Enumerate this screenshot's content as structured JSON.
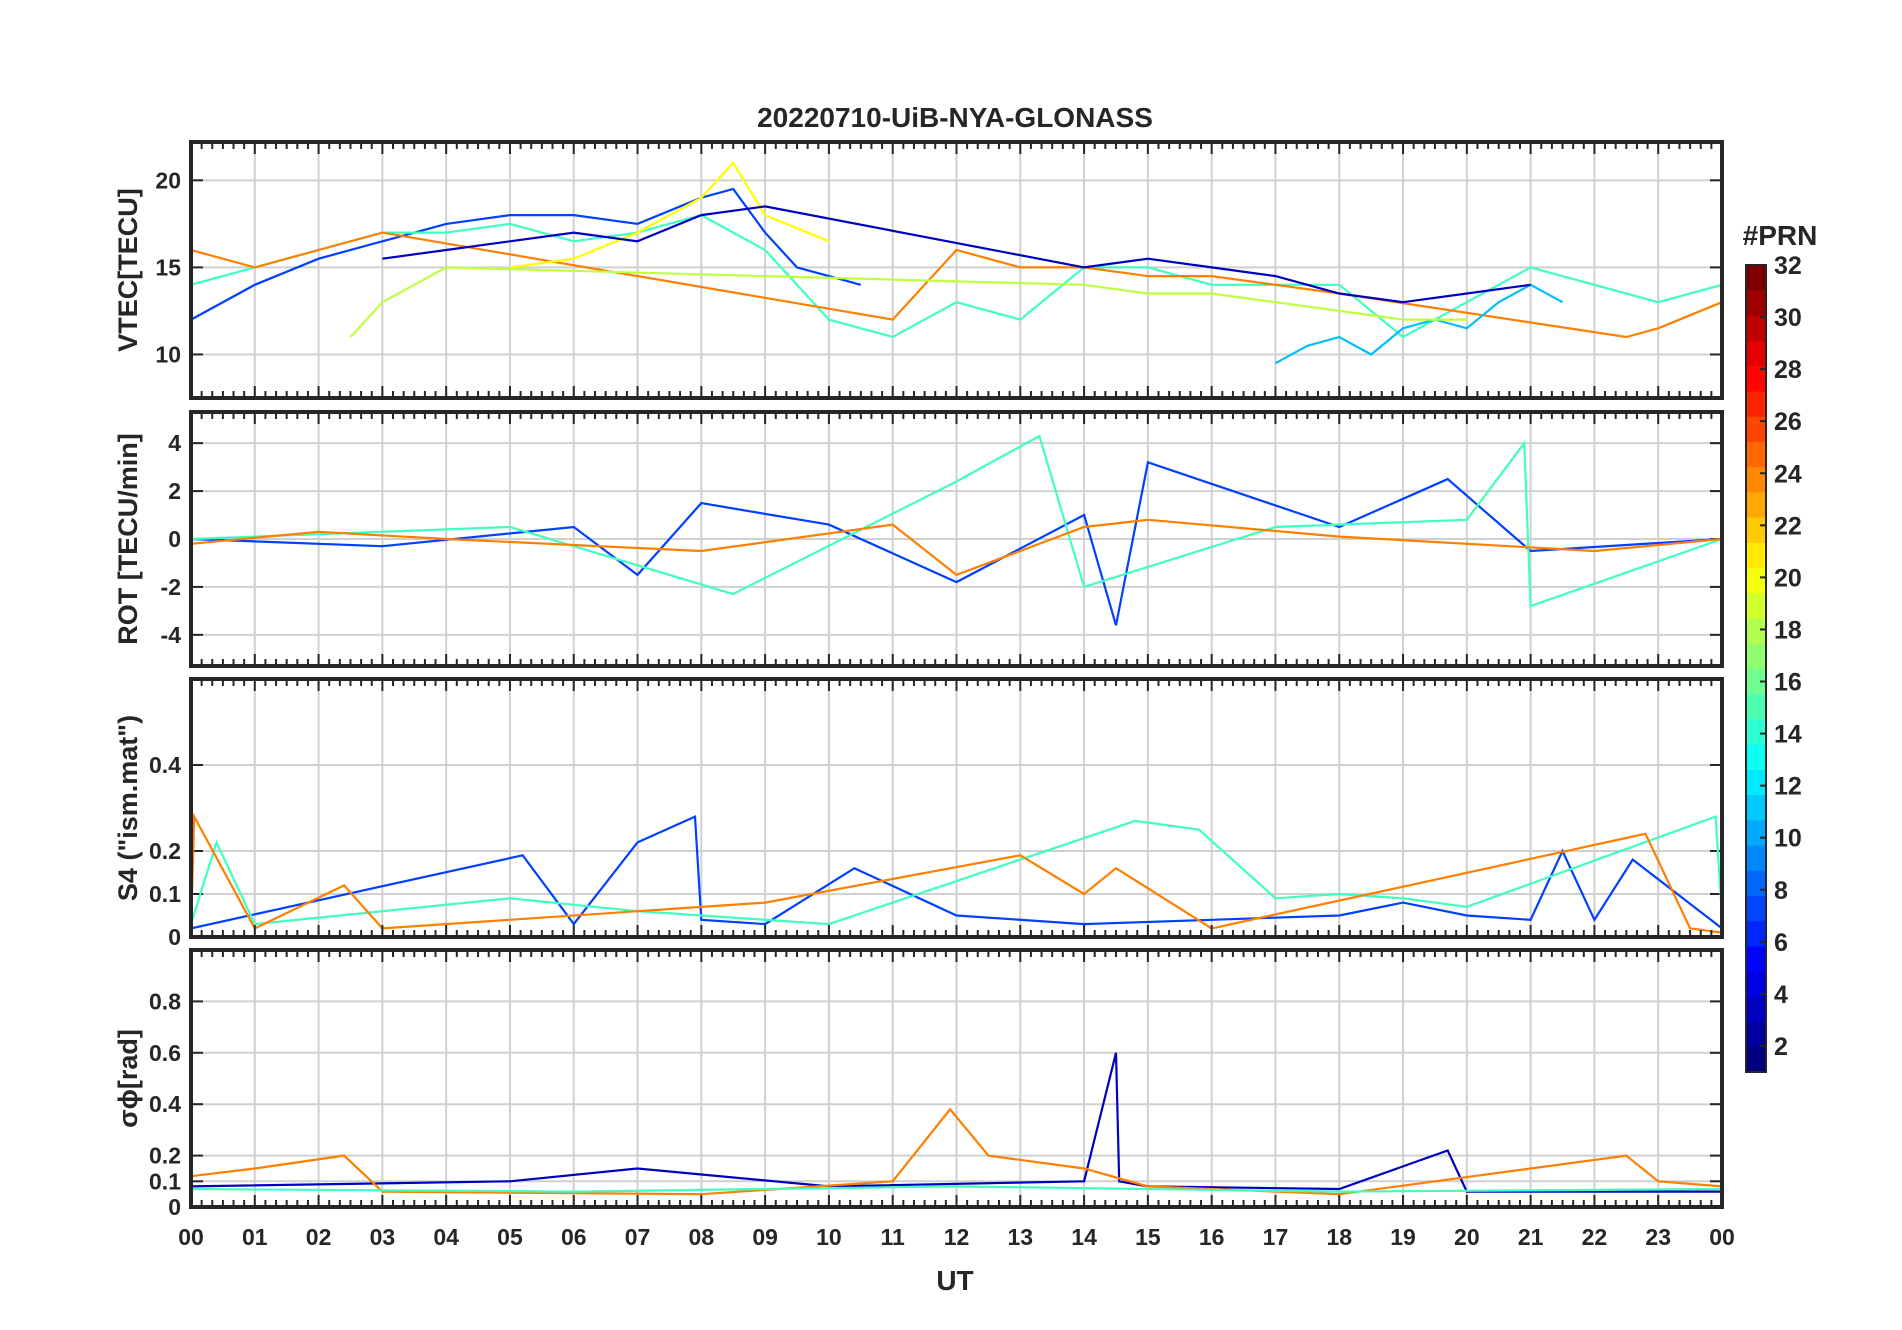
{
  "title": "20220710-UiB-NYA-GLONASS",
  "xlabel": "UT",
  "x_tick_labels": [
    "00",
    "01",
    "02",
    "03",
    "04",
    "05",
    "06",
    "07",
    "08",
    "09",
    "10",
    "11",
    "12",
    "13",
    "14",
    "15",
    "16",
    "17",
    "18",
    "19",
    "20",
    "21",
    "22",
    "23",
    "00"
  ],
  "colorbar": {
    "title": "#PRN",
    "range": [
      1,
      32
    ],
    "tick_labels": [
      "2",
      "4",
      "6",
      "8",
      "10",
      "12",
      "14",
      "16",
      "18",
      "20",
      "22",
      "24",
      "26",
      "28",
      "30",
      "32"
    ],
    "colormap": "jet"
  },
  "chart_data": [
    {
      "type": "line",
      "panel": "vtec",
      "ylabel": "VTEC[TECU]",
      "ylim": [
        7.5,
        22.2
      ],
      "yticks": [
        10,
        15,
        20
      ],
      "y_tick_labels": [
        "10",
        "15",
        "20"
      ],
      "xlim_hours": [
        0,
        24
      ],
      "grid": true,
      "series": [
        {
          "prn": 4,
          "color": "#0040ff",
          "x": [
            0,
            1,
            2,
            3,
            4,
            5,
            6,
            7,
            8,
            8.5,
            9,
            9.5,
            10,
            10.5
          ],
          "y": [
            12,
            14,
            15.5,
            16.5,
            17.5,
            18,
            18,
            17.5,
            19,
            19.5,
            17,
            15,
            14.5,
            14
          ]
        },
        {
          "prn": 15,
          "color": "#40ffbf",
          "x": [
            0,
            1,
            2,
            3,
            4,
            5,
            6,
            7,
            8,
            9,
            10,
            11,
            12,
            13,
            14,
            15,
            16,
            17,
            18,
            19,
            20,
            21,
            22,
            23,
            24
          ],
          "y": [
            14,
            15,
            16,
            17,
            17,
            17.5,
            16.5,
            17,
            18,
            16,
            12,
            11,
            13,
            12,
            15,
            15,
            14,
            14,
            14,
            11,
            13,
            15,
            14,
            13,
            14
          ]
        },
        {
          "prn": 23,
          "color": "#ff7f00",
          "x": [
            0,
            1,
            2,
            3,
            11,
            12,
            13,
            14,
            15,
            16,
            17,
            18,
            22.5,
            23,
            24
          ],
          "y": [
            16,
            15,
            16,
            17,
            12,
            16,
            15,
            15,
            14.5,
            14.5,
            14,
            13.5,
            11,
            11.5,
            13
          ]
        },
        {
          "prn": 20,
          "color": "#ffff00",
          "x": [
            5,
            6,
            7,
            8,
            8.5,
            9,
            10
          ],
          "y": [
            15,
            15.5,
            17,
            19,
            21,
            18,
            16.5
          ]
        },
        {
          "prn": 11,
          "color": "#00bfff",
          "x": [
            17,
            17.5,
            18,
            18.5,
            19,
            19.5,
            20,
            20.5,
            21,
            21.5
          ],
          "y": [
            9.5,
            10.5,
            11,
            10,
            11.5,
            12,
            11.5,
            13,
            14,
            13
          ]
        },
        {
          "prn": 2,
          "color": "#0000bf",
          "x": [
            3,
            4,
            5,
            6,
            7,
            8,
            9,
            14,
            15,
            16,
            17,
            18,
            19,
            20,
            21
          ],
          "y": [
            15.5,
            16,
            16.5,
            17,
            16.5,
            18,
            18.5,
            15,
            15.5,
            15,
            14.5,
            13.5,
            13,
            13.5,
            14
          ]
        },
        {
          "prn": 18,
          "color": "#bfff40",
          "x": [
            2.5,
            3,
            4,
            14,
            15,
            16,
            17,
            18,
            19,
            20
          ],
          "y": [
            11,
            13,
            15,
            14,
            13.5,
            13.5,
            13,
            12.5,
            12,
            12
          ]
        }
      ]
    },
    {
      "type": "line",
      "panel": "rot",
      "ylabel": "ROT [TECU/min]",
      "ylim": [
        -5.3,
        5.3
      ],
      "yticks": [
        -4,
        -2,
        0,
        2,
        4
      ],
      "y_tick_labels": [
        "-4",
        "-2",
        "0",
        "2",
        "4"
      ],
      "xlim_hours": [
        0,
        24
      ],
      "grid": true,
      "series": [
        {
          "prn": 4,
          "color": "#0040ff",
          "x": [
            0,
            3,
            6,
            7,
            8,
            10,
            12,
            14,
            14.5,
            15,
            18,
            19.7,
            21,
            24
          ],
          "y": [
            0,
            -0.3,
            0.5,
            -1.5,
            1.5,
            0.6,
            -1.8,
            1,
            -3.6,
            3.2,
            0.5,
            2.5,
            -0.5,
            0
          ]
        },
        {
          "prn": 15,
          "color": "#40ffbf",
          "x": [
            0,
            5,
            8.5,
            12,
            13.3,
            14,
            17,
            20,
            20.9,
            21,
            24
          ],
          "y": [
            0,
            0.5,
            -2.3,
            2.4,
            4.3,
            -2,
            0.5,
            0.8,
            4,
            -2.8,
            0
          ]
        },
        {
          "prn": 23,
          "color": "#ff7f00",
          "x": [
            0,
            2,
            4,
            8,
            11,
            12,
            14,
            15,
            18,
            22,
            24
          ],
          "y": [
            -0.2,
            0.3,
            0,
            -0.5,
            0.6,
            -1.5,
            0.5,
            0.8,
            0.1,
            -0.5,
            0
          ]
        }
      ]
    },
    {
      "type": "line",
      "panel": "s4",
      "ylabel": "S4 (\"ism.mat\")",
      "ylim": [
        0,
        0.6
      ],
      "yticks": [
        0,
        0.1,
        0.2,
        0.4
      ],
      "y_tick_labels": [
        "0",
        "0.1",
        "0.2",
        "0.4"
      ],
      "xlim_hours": [
        0,
        24
      ],
      "grid": true,
      "series": [
        {
          "prn": 4,
          "color": "#0040ff",
          "x": [
            0,
            5.2,
            6,
            7,
            7.9,
            8,
            9,
            10.4,
            12,
            14,
            16,
            18,
            19,
            20,
            21,
            21.5,
            22,
            22.6,
            24
          ],
          "y": [
            0.02,
            0.19,
            0.03,
            0.22,
            0.28,
            0.04,
            0.03,
            0.16,
            0.05,
            0.03,
            0.04,
            0.05,
            0.08,
            0.05,
            0.04,
            0.2,
            0.04,
            0.18,
            0.02
          ]
        },
        {
          "prn": 15,
          "color": "#40ffbf",
          "x": [
            0,
            0.4,
            1,
            5,
            7,
            10,
            14.8,
            15.8,
            17,
            18,
            19,
            20,
            23.9,
            24
          ],
          "y": [
            0.03,
            0.22,
            0.03,
            0.09,
            0.06,
            0.03,
            0.27,
            0.25,
            0.09,
            0.1,
            0.09,
            0.07,
            0.28,
            0.05
          ]
        },
        {
          "prn": 23,
          "color": "#ff7f00",
          "x": [
            0,
            0.05,
            1,
            2.4,
            3,
            9,
            13,
            14,
            14.5,
            16,
            22.8,
            23.5,
            24
          ],
          "y": [
            0.02,
            0.28,
            0.02,
            0.12,
            0.02,
            0.08,
            0.19,
            0.1,
            0.16,
            0.02,
            0.24,
            0.02,
            0.01
          ]
        }
      ]
    },
    {
      "type": "line",
      "panel": "sigma_phi",
      "ylabel": "σϕ[rad]",
      "ylim": [
        0,
        1.0
      ],
      "yticks": [
        0,
        0.1,
        0.2,
        0.4,
        0.6,
        0.8
      ],
      "y_tick_labels": [
        "0",
        "0.1",
        "0.2",
        "0.4",
        "0.6",
        "0.8"
      ],
      "xlim_hours": [
        0,
        24
      ],
      "grid": true,
      "series": [
        {
          "prn": 4,
          "color": "#0000bf",
          "x": [
            0,
            5,
            7,
            10,
            14,
            14.5,
            14.55,
            15,
            18,
            19.7,
            20,
            24
          ],
          "y": [
            0.08,
            0.1,
            0.15,
            0.08,
            0.1,
            0.6,
            0.1,
            0.08,
            0.07,
            0.22,
            0.06,
            0.06
          ]
        },
        {
          "prn": 23,
          "color": "#ff7f00",
          "x": [
            0,
            1,
            2.4,
            3,
            8,
            11,
            11.9,
            12.5,
            14,
            15,
            18,
            22.5,
            23,
            24
          ],
          "y": [
            0.12,
            0.15,
            0.2,
            0.06,
            0.05,
            0.1,
            0.38,
            0.2,
            0.15,
            0.08,
            0.05,
            0.2,
            0.1,
            0.08
          ]
        },
        {
          "prn": 15,
          "color": "#40ffbf",
          "x": [
            0,
            6,
            12,
            18,
            24
          ],
          "y": [
            0.07,
            0.06,
            0.08,
            0.06,
            0.07
          ]
        }
      ]
    }
  ]
}
